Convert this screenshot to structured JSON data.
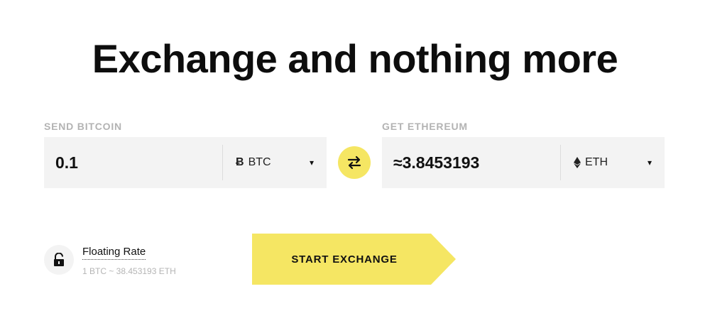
{
  "title": "Exchange and nothing more",
  "send": {
    "label": "SEND BITCOIN",
    "amount": "0.1",
    "currency_icon": "Ƀ",
    "currency_icon_name": "bitcoin-icon",
    "currency": "BTC",
    "caret": "▾"
  },
  "get": {
    "label": "GET ETHEREUM",
    "amount": "≈3.8453193",
    "currency_icon": "⧫",
    "currency_icon_name": "ethereum-icon",
    "currency": "ETH",
    "caret": "▾"
  },
  "swap": {
    "icon": "swap-arrows-icon"
  },
  "rate": {
    "icon": "unlock-icon",
    "title": "Floating Rate",
    "subtitle": "1 BTC ~ 38.453193 ETH"
  },
  "cta": {
    "label": "START EXCHANGE"
  },
  "colors": {
    "accent": "#f5e663",
    "field_bg": "#f3f3f3",
    "label_gray": "#b3b3b3"
  }
}
